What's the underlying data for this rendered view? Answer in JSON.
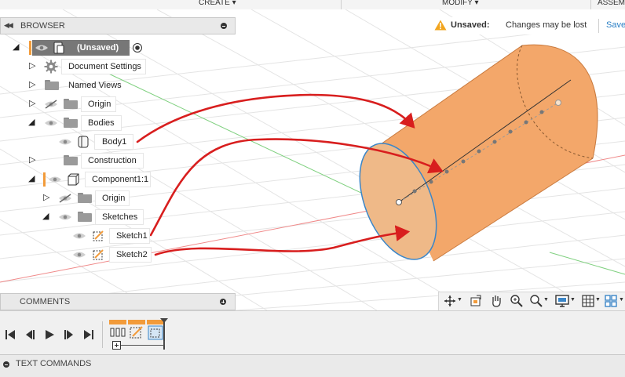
{
  "toolbar": {
    "menus": [
      {
        "label": "CREATE ▾"
      },
      {
        "label": "MODIFY ▾"
      },
      {
        "label": "ASSEM"
      }
    ]
  },
  "browser": {
    "title": "BROWSER",
    "root_label": "(Unsaved)",
    "items": [
      {
        "label": "Document Settings"
      },
      {
        "label": "Named Views"
      },
      {
        "label": "Origin"
      },
      {
        "label": "Bodies"
      },
      {
        "label": "Body1"
      },
      {
        "label": "Construction"
      },
      {
        "label": "Component1:1"
      },
      {
        "label": "Origin"
      },
      {
        "label": "Sketches"
      },
      {
        "label": "Sketch1"
      },
      {
        "label": "Sketch2"
      }
    ]
  },
  "status": {
    "unsaved_label": "Unsaved:",
    "message": "Changes may be lost",
    "save_label": "Save"
  },
  "comments": {
    "title": "COMMENTS"
  },
  "text_commands": {
    "title": "TEXT COMMANDS"
  },
  "icons": {
    "gear": "gear-icon",
    "eye": "eye-icon",
    "eye_hidden": "eye-hidden-icon",
    "folder": "folder-icon",
    "body": "body-icon",
    "component": "component-icon",
    "sketch": "sketch-icon",
    "warning": "warning-icon"
  },
  "colors": {
    "body_fill": "#f3a76a",
    "annotation_red": "#d81e1e",
    "accent_orange": "#f29b3a",
    "link_blue": "#2a7fc5",
    "warning_amber": "#f2a51e"
  }
}
